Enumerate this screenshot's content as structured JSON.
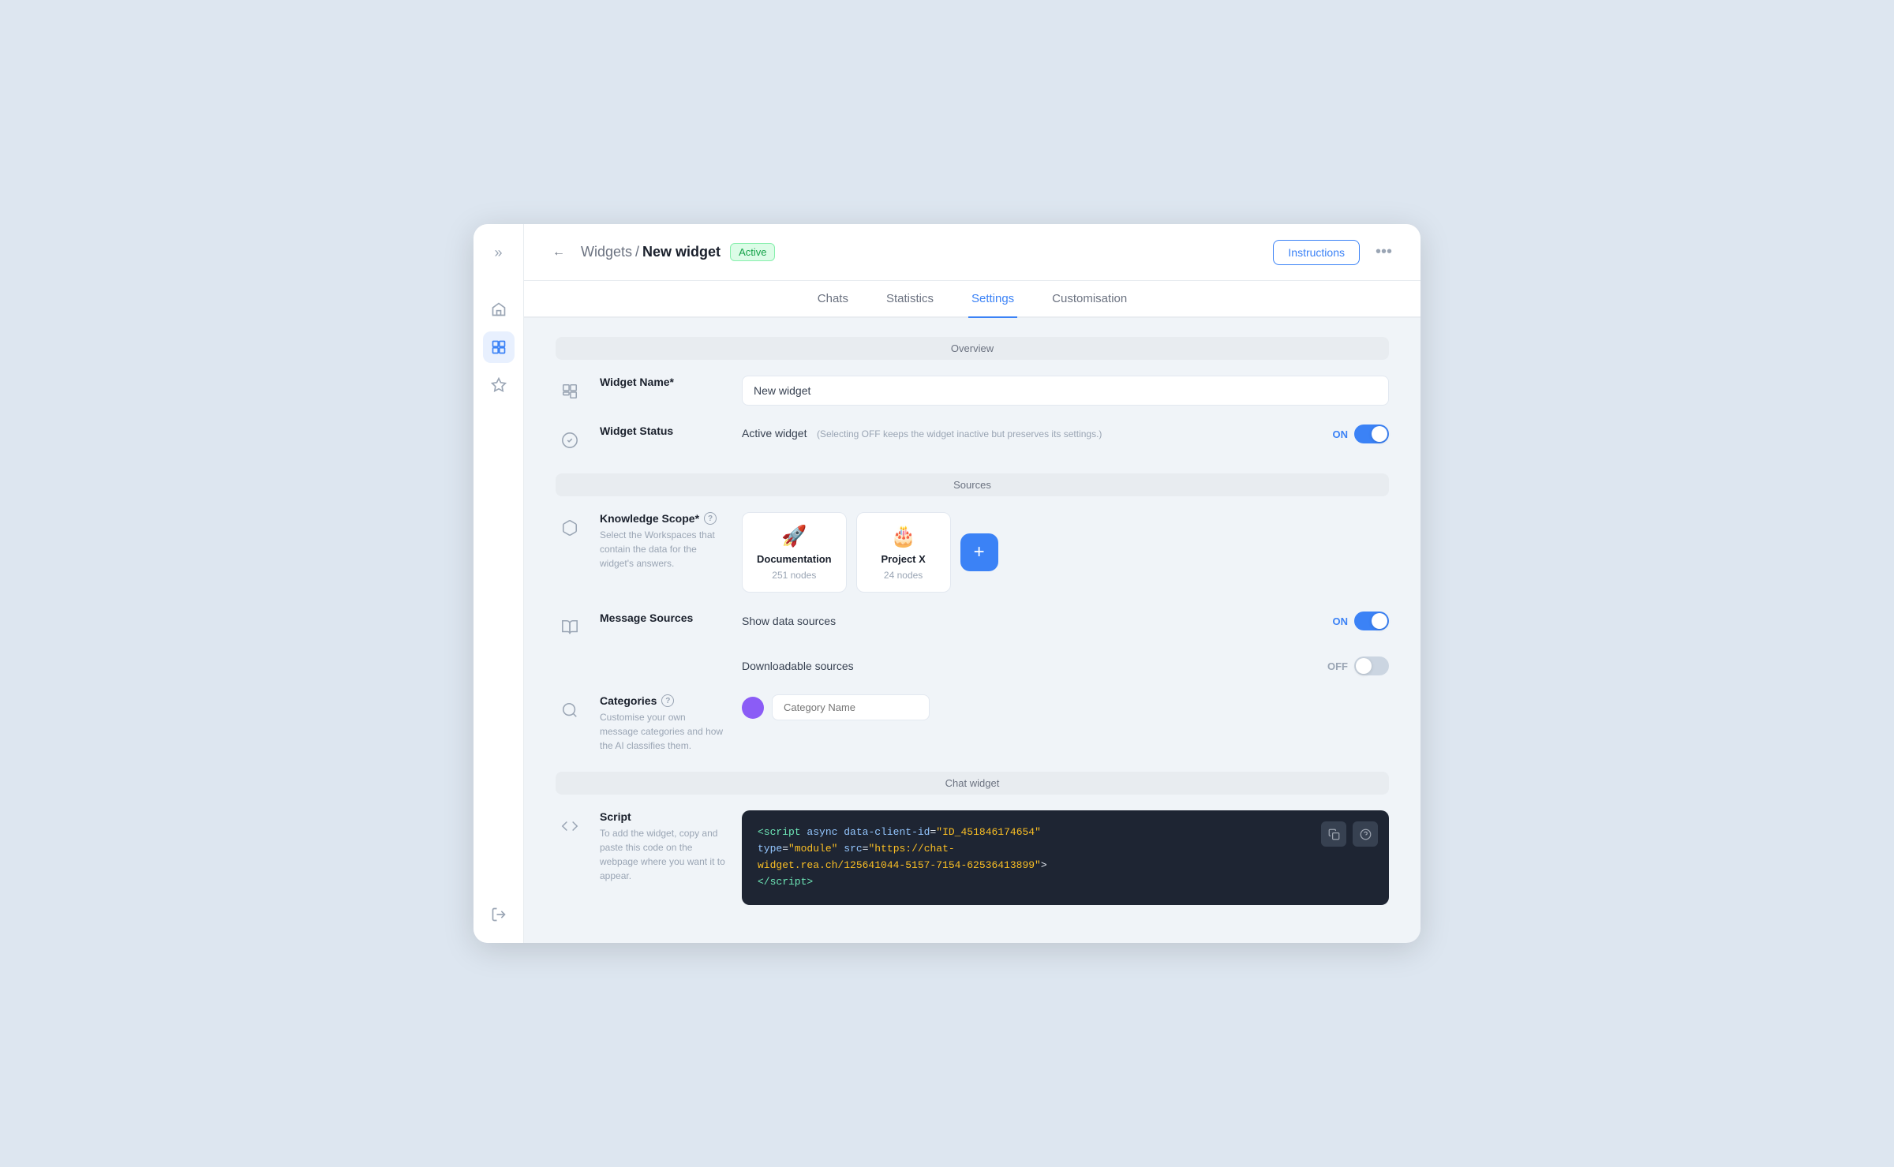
{
  "sidebar": {
    "collapse_icon": "»",
    "items": [
      {
        "id": "home",
        "icon": "⌂",
        "active": false
      },
      {
        "id": "widgets",
        "icon": "⊞",
        "active": true
      },
      {
        "id": "favorites",
        "icon": "☆",
        "active": false
      }
    ],
    "logout_icon": "⇥"
  },
  "header": {
    "back_icon": "←",
    "breadcrumb_parent": "Widgets",
    "separator": "/",
    "breadcrumb_current": "New widget",
    "status_badge": "Active",
    "instructions_label": "Instructions",
    "more_icon": "•••"
  },
  "tabs": [
    {
      "id": "chats",
      "label": "Chats",
      "active": false
    },
    {
      "id": "statistics",
      "label": "Statistics",
      "active": false
    },
    {
      "id": "settings",
      "label": "Settings",
      "active": true
    },
    {
      "id": "customisation",
      "label": "Customisation",
      "active": false
    }
  ],
  "sections": {
    "overview": {
      "label": "Overview",
      "widget_name": {
        "label": "Widget Name*",
        "placeholder": "New widget",
        "value": "New widget"
      },
      "widget_status": {
        "label": "Widget Status",
        "description": "Active widget",
        "hint": "(Selecting OFF keeps the widget inactive but preserves its settings.)",
        "state": "ON",
        "on": true
      }
    },
    "sources": {
      "label": "Sources",
      "knowledge_scope": {
        "label": "Knowledge Scope*",
        "sublabel": "Select the Workspaces that contain the data for the widget's answers.",
        "workspaces": [
          {
            "id": "documentation",
            "emoji": "🚀",
            "name": "Documentation",
            "nodes": "251 nodes"
          },
          {
            "id": "project-x",
            "emoji": "🎂",
            "name": "Project X",
            "nodes": "24 nodes"
          }
        ],
        "add_label": "+"
      },
      "message_sources": {
        "label": "Message Sources",
        "show_data_sources": {
          "label": "Show data sources",
          "state": "ON",
          "on": true
        },
        "downloadable_sources": {
          "label": "Downloadable sources",
          "state": "OFF",
          "on": false
        }
      },
      "categories": {
        "label": "Categories",
        "sublabel": "Customise your own message categories and how the AI classifies them.",
        "color": "#8b5cf6",
        "placeholder": "Category Name"
      }
    },
    "chat_widget": {
      "label": "Chat widget",
      "script": {
        "label": "Script",
        "sublabel": "To add the widget, copy and paste this code on the webpage where you want it to appear.",
        "code_line1": "<script async data-client-id=\"ID_451846174654\"",
        "code_line2": "type=\"module\" src=\"https://chat-",
        "code_line3": "widget.rea.ch/125641044-5157-7154-62536413899\">",
        "code_line4": "</script>",
        "copy_icon": "copy",
        "help_icon": "?"
      }
    }
  }
}
